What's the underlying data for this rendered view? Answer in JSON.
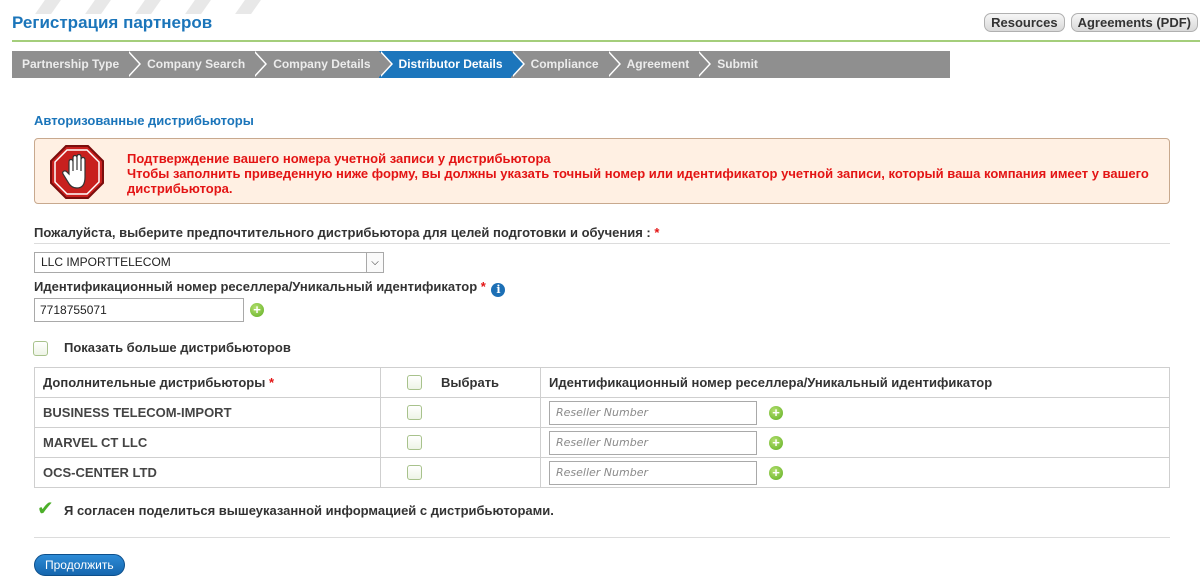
{
  "header": {
    "title": "Регистрация партнеров",
    "buttons": [
      "Resources",
      "Agreements (PDF)"
    ]
  },
  "wizard": {
    "steps": [
      "Partnership Type",
      "Company Search",
      "Company Details",
      "Distributor Details",
      "Compliance",
      "Agreement",
      "Submit"
    ],
    "active_index": 3
  },
  "section_title": "Авторизованные дистрибьюторы",
  "alert": {
    "icon": "stop-hand-icon",
    "line1": "Подтверждение вашего номера учетной записи у дистрибьютора",
    "line2": "Чтобы заполнить приведенную ниже форму, вы должны указать точный номер или идентификатор учетной записи, который ваша компания имеет у вашего дистрибьютора."
  },
  "preferred": {
    "label": "Пожалуйста, выберите предпочтительного дистрибьютора для целей подготовки и обучения :",
    "required_mark": "*",
    "selected": "LLC IMPORTTELECOM"
  },
  "reseller_id": {
    "label": "Идентификационный номер реселлера/Уникальный идентификатор",
    "required_mark": "*",
    "value": "7718755071"
  },
  "show_more_label": "Показать больше дистрибьюторов",
  "table": {
    "headers": {
      "distributors": "Дополнительные дистрибьюторы",
      "required_mark": "*",
      "select": "Выбрать",
      "reseller": "Идентификационный номер реселлера/Уникальный идентификатор"
    },
    "rows": [
      {
        "name": "BUSINESS TELECOM-IMPORT",
        "placeholder": "Reseller Number"
      },
      {
        "name": "MARVEL CT LLC",
        "placeholder": "Reseller Number"
      },
      {
        "name": "OCS-CENTER LTD",
        "placeholder": "Reseller Number"
      }
    ]
  },
  "agree_label": "Я согласен поделиться вышеуказанной информацией с дистрибьюторами.",
  "continue_label": "Продолжить",
  "colors": {
    "brand_blue": "#1b75ba",
    "accent_green": "#a4ce7b",
    "alert_red": "#e31414",
    "wizard_gray": "#8f8f8f"
  }
}
